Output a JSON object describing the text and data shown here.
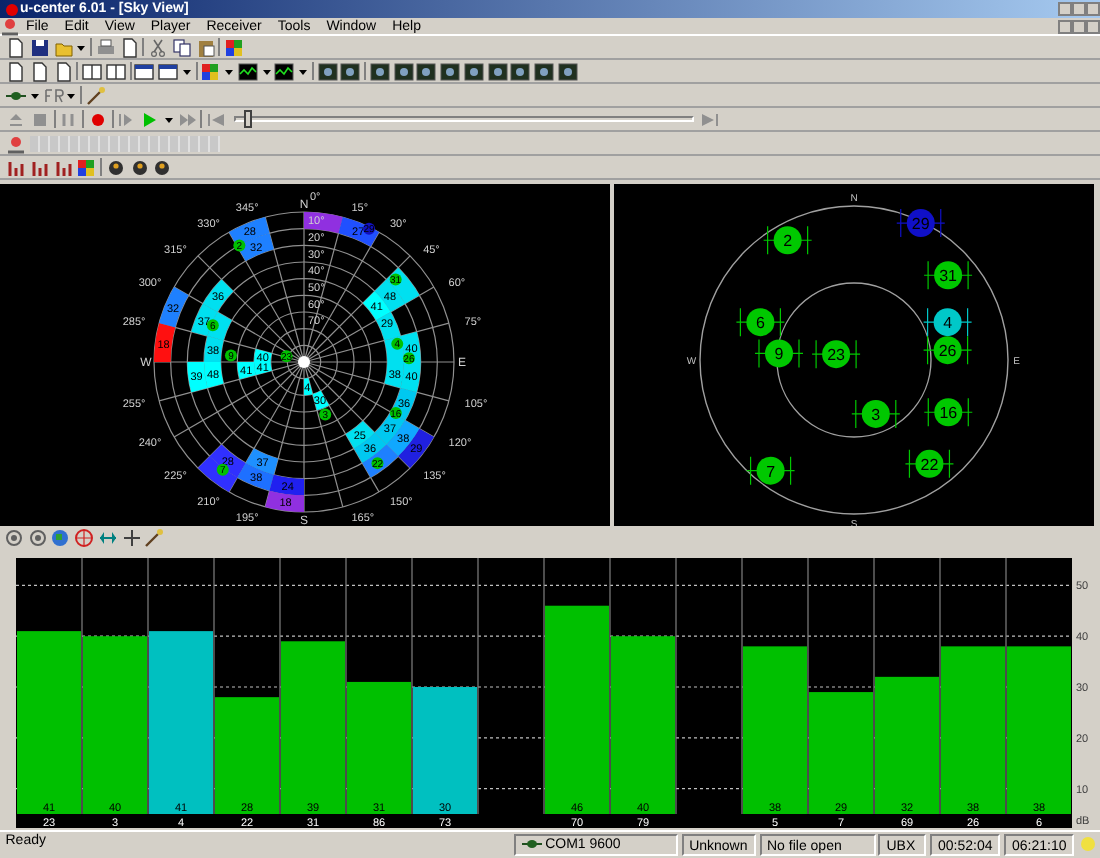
{
  "window": {
    "title": "u-center 6.01 - [Sky View]"
  },
  "menu": [
    "File",
    "Edit",
    "View",
    "Player",
    "Receiver",
    "Tools",
    "Window",
    "Help"
  ],
  "player": {
    "level": 0.02
  },
  "sky_plot": {
    "compass": [
      "N",
      "E",
      "S",
      "W"
    ],
    "azimuth_labels": [
      "0°",
      "15°",
      "30°",
      "45°",
      "60°",
      "75°",
      "105°",
      "120°",
      "135°",
      "150°",
      "165°",
      "195°",
      "210°",
      "225°",
      "240°",
      "255°",
      "285°",
      "300°",
      "315°",
      "330°",
      "345°"
    ],
    "elevation_labels": [
      "10°",
      "20°",
      "30°",
      "40°",
      "50°",
      "60°",
      "70°"
    ],
    "cells": [
      {
        "color": "#9030e0"
      },
      {
        "text": "28",
        "color": "#1e80ff"
      },
      {
        "text": "27",
        "color": "#2050ff"
      },
      {
        "text": "32",
        "color": "#1e80ff"
      },
      {
        "color": "#00e0f0"
      },
      {
        "text": "36",
        "color": "#00e0f0"
      },
      {
        "text": "48",
        "color": "#00e0f0"
      },
      {
        "text": "41",
        "color": "#00ffff"
      },
      {
        "text": "32",
        "color": "#1e80ff"
      },
      {
        "text": "37",
        "color": "#00e0f0"
      },
      {
        "color": "#00e0f0"
      },
      {
        "text": "29",
        "color": "#00e0f0"
      },
      {
        "text": "18",
        "color": "#ff1010"
      },
      {
        "text": "38",
        "color": "#00e0f0"
      },
      {
        "text": "40",
        "color": "#00e0f0"
      },
      {
        "color": "#00e0f0"
      },
      {
        "text": "40",
        "color": "#00ffff"
      },
      {
        "text": "39",
        "color": "#00ffff"
      },
      {
        "text": "48",
        "color": "#00ffff"
      },
      {
        "text": "41",
        "color": "#00ffff"
      },
      {
        "text": "41",
        "color": "#00ffff"
      },
      {
        "text": "38",
        "color": "#00e0f0"
      },
      {
        "text": "40",
        "color": "#00e0f0"
      },
      {
        "text": "4",
        "color": "#00ffff"
      },
      {
        "text": "30",
        "color": "#00ffff"
      },
      {
        "text": "36",
        "color": "#00c8f0"
      },
      {
        "text": "37",
        "color": "#00c8f0"
      },
      {
        "text": "25",
        "color": "#00e0f0"
      },
      {
        "text": "38",
        "color": "#10a8ff"
      },
      {
        "text": "36",
        "color": "#00c8f0"
      },
      {
        "text": "29",
        "color": "#2020e0"
      },
      {
        "text": "28",
        "color": "#3030ff"
      },
      {
        "color": "#1e80ff"
      },
      {
        "text": "37",
        "color": "#1e90ff"
      },
      {
        "color": "#3030ff"
      },
      {
        "text": "38",
        "color": "#1e70ff"
      },
      {
        "text": "24",
        "color": "#2020f0"
      },
      {
        "text": "18",
        "color": "#9030e0"
      }
    ],
    "satellites": [
      {
        "prn": "2",
        "color": "#00c000"
      },
      {
        "prn": "29",
        "color": "#1010c0"
      },
      {
        "prn": "31",
        "color": "#00c000"
      },
      {
        "prn": "6",
        "color": "#00c000"
      },
      {
        "prn": "4",
        "color": "#00c000"
      },
      {
        "prn": "9",
        "color": "#00c000"
      },
      {
        "prn": "23",
        "color": "#00c000"
      },
      {
        "prn": "26",
        "color": "#00c000"
      },
      {
        "prn": "3",
        "color": "#00c000"
      },
      {
        "prn": "16",
        "color": "#00c000"
      },
      {
        "prn": "7",
        "color": "#00c000"
      },
      {
        "prn": "22",
        "color": "#00c000"
      }
    ]
  },
  "position_plot": {
    "compass": [
      "N",
      "E",
      "S",
      "W"
    ],
    "satellites": [
      {
        "prn": "2",
        "color": "#00c800"
      },
      {
        "prn": "29",
        "color": "#1010c8"
      },
      {
        "prn": "31",
        "color": "#00c800"
      },
      {
        "prn": "6",
        "color": "#00c800"
      },
      {
        "prn": "4",
        "color": "#00c8c8"
      },
      {
        "prn": "9",
        "color": "#00c800"
      },
      {
        "prn": "23",
        "color": "#00c800"
      },
      {
        "prn": "26",
        "color": "#00c800"
      },
      {
        "prn": "3",
        "color": "#00c800"
      },
      {
        "prn": "16",
        "color": "#00c800"
      },
      {
        "prn": "7",
        "color": "#00c800"
      },
      {
        "prn": "22",
        "color": "#00c800"
      }
    ]
  },
  "signal_chart": {
    "chart_data": {
      "type": "bar",
      "ylabel": "dB",
      "categories": [
        "23",
        "3",
        "4",
        "22",
        "31",
        "86",
        "73",
        "70",
        "79",
        "5",
        "7",
        "69",
        "26",
        "6"
      ],
      "series": [
        {
          "color": "#00c000",
          "values": [
            41,
            40,
            null,
            28,
            39,
            31,
            null,
            46,
            40,
            38,
            29,
            32,
            38,
            38
          ]
        },
        {
          "color": "#00c0c0",
          "values": [
            null,
            null,
            41,
            null,
            null,
            null,
            30,
            null,
            null,
            null,
            null,
            null,
            null,
            null
          ]
        }
      ],
      "grid": true,
      "ylim": [
        5,
        55
      ],
      "yticks": [
        10,
        20,
        30,
        40,
        50
      ],
      "data_labels": true
    }
  },
  "status_bar": {
    "message": "Ready",
    "port": "COM1 9600",
    "receiver": "Unknown",
    "file": "No file open",
    "protocol": "UBX",
    "elapsed": "00:52:04",
    "time": "06:21:10"
  }
}
